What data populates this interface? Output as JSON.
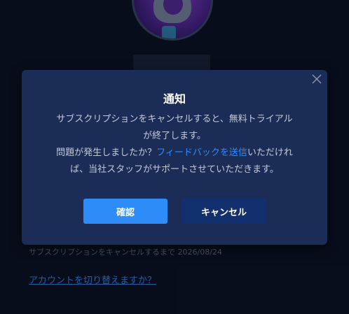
{
  "background": {
    "subscription_text": "サブスクリプションをキャンセルするまで 2026/08/24",
    "switch_account_link": "アカウントを切り替えますか？"
  },
  "dialog": {
    "title": "通知",
    "body_line1": "サブスクリプションをキャンセルすると、無料トライアル",
    "body_line2": "が終了します。",
    "body_line3_prefix": "問題が発生しましたか？",
    "body_line3_link": "フィードバックを送信",
    "body_line3_suffix": "いただけれ",
    "body_line4": "ば、当社スタッフがサポートさせていただきます。",
    "confirm_label": "確認",
    "cancel_label": "キャンセル",
    "close_icon": "close-icon"
  },
  "colors": {
    "page_background": "#0a1020",
    "dialog_background": "#1b2c57",
    "confirm_button": "#2d8cf7",
    "cancel_button": "#13306e",
    "link": "#2e8bff"
  }
}
